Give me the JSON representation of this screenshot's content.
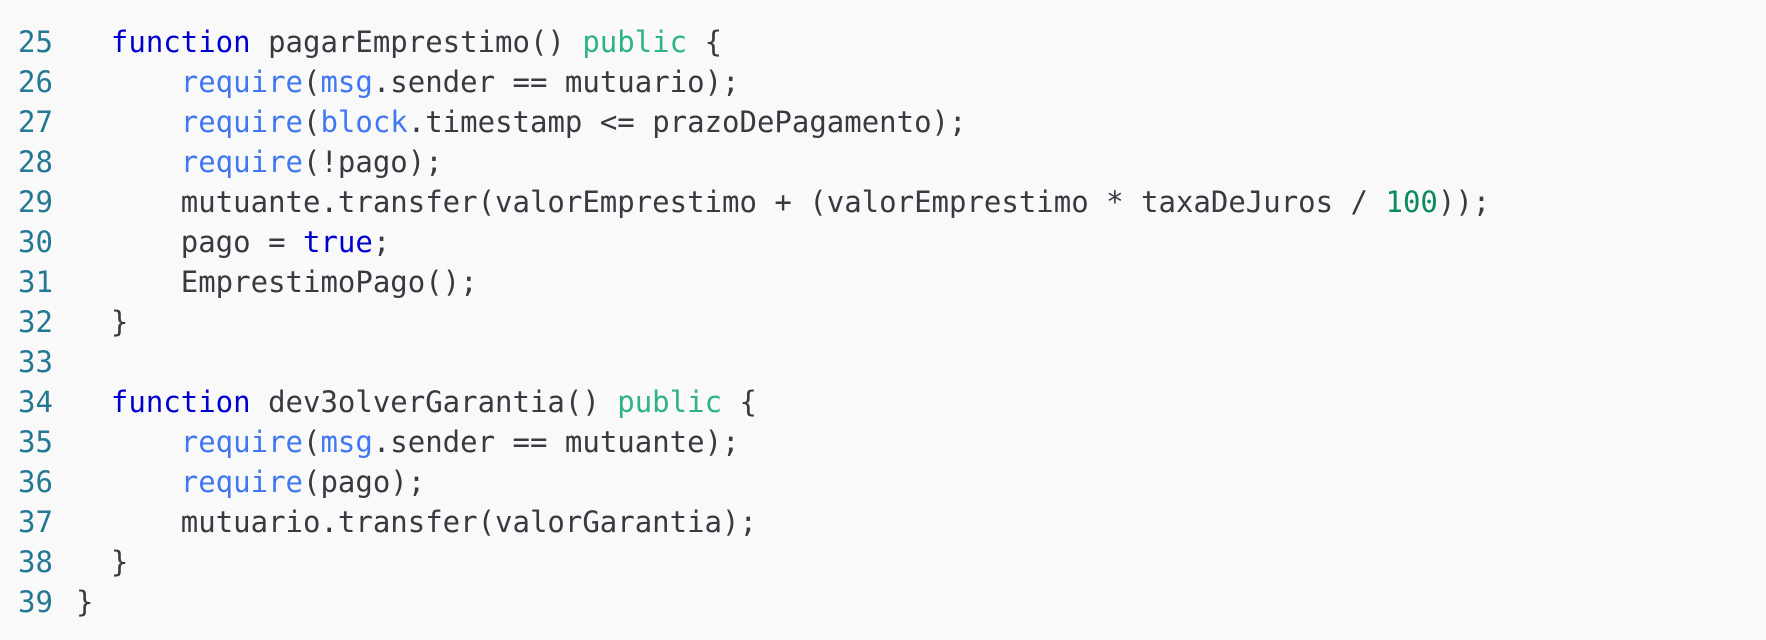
{
  "colors": {
    "background": "#f9f9f9",
    "line_number": "#237893",
    "plain": "#383a42",
    "keyword": "#0000cc",
    "visibility": "#2fb384",
    "builtin": "#4078f2",
    "literal": "#0000cc",
    "number": "#0b8a5c"
  },
  "lines": [
    {
      "number": "25",
      "indent": "  ",
      "tokens": [
        {
          "t": "function",
          "c": "keyword"
        },
        {
          "t": " pagarEmprestimo() ",
          "c": "plain"
        },
        {
          "t": "public",
          "c": "visibility"
        },
        {
          "t": " {",
          "c": "plain"
        }
      ]
    },
    {
      "number": "26",
      "indent": "      ",
      "tokens": [
        {
          "t": "require",
          "c": "builtin"
        },
        {
          "t": "(",
          "c": "plain"
        },
        {
          "t": "msg",
          "c": "builtin"
        },
        {
          "t": ".sender == mutuario);",
          "c": "plain"
        }
      ]
    },
    {
      "number": "27",
      "indent": "      ",
      "tokens": [
        {
          "t": "require",
          "c": "builtin"
        },
        {
          "t": "(",
          "c": "plain"
        },
        {
          "t": "block",
          "c": "builtin"
        },
        {
          "t": ".timestamp <= prazoDePagamento);",
          "c": "plain"
        }
      ]
    },
    {
      "number": "28",
      "indent": "      ",
      "tokens": [
        {
          "t": "require",
          "c": "builtin"
        },
        {
          "t": "(!pago);",
          "c": "plain"
        }
      ]
    },
    {
      "number": "29",
      "indent": "      ",
      "tokens": [
        {
          "t": "mutuante.transfer(valorEmprestimo + (valorEmprestimo * taxaDeJuros / ",
          "c": "plain"
        },
        {
          "t": "100",
          "c": "number"
        },
        {
          "t": "));",
          "c": "plain"
        }
      ]
    },
    {
      "number": "30",
      "indent": "      ",
      "tokens": [
        {
          "t": "pago = ",
          "c": "plain"
        },
        {
          "t": "true",
          "c": "literal"
        },
        {
          "t": ";",
          "c": "plain"
        }
      ]
    },
    {
      "number": "31",
      "indent": "      ",
      "tokens": [
        {
          "t": "EmprestimoPago();",
          "c": "plain"
        }
      ]
    },
    {
      "number": "32",
      "indent": "  ",
      "tokens": [
        {
          "t": "}",
          "c": "plain"
        }
      ]
    },
    {
      "number": "33",
      "indent": "",
      "tokens": []
    },
    {
      "number": "34",
      "indent": "  ",
      "tokens": [
        {
          "t": "function",
          "c": "keyword"
        },
        {
          "t": " dev3olverGarantia() ",
          "c": "plain"
        },
        {
          "t": "public",
          "c": "visibility"
        },
        {
          "t": " {",
          "c": "plain"
        }
      ]
    },
    {
      "number": "35",
      "indent": "      ",
      "tokens": [
        {
          "t": "require",
          "c": "builtin"
        },
        {
          "t": "(",
          "c": "plain"
        },
        {
          "t": "msg",
          "c": "builtin"
        },
        {
          "t": ".sender == mutuante);",
          "c": "plain"
        }
      ]
    },
    {
      "number": "36",
      "indent": "      ",
      "tokens": [
        {
          "t": "require",
          "c": "builtin"
        },
        {
          "t": "(pago);",
          "c": "plain"
        }
      ]
    },
    {
      "number": "37",
      "indent": "      ",
      "tokens": [
        {
          "t": "mutuario.transfer(valorGarantia);",
          "c": "plain"
        }
      ]
    },
    {
      "number": "38",
      "indent": "  ",
      "tokens": [
        {
          "t": "}",
          "c": "plain"
        }
      ]
    },
    {
      "number": "39",
      "indent": "",
      "tokens": [
        {
          "t": "}",
          "c": "plain"
        }
      ]
    }
  ]
}
